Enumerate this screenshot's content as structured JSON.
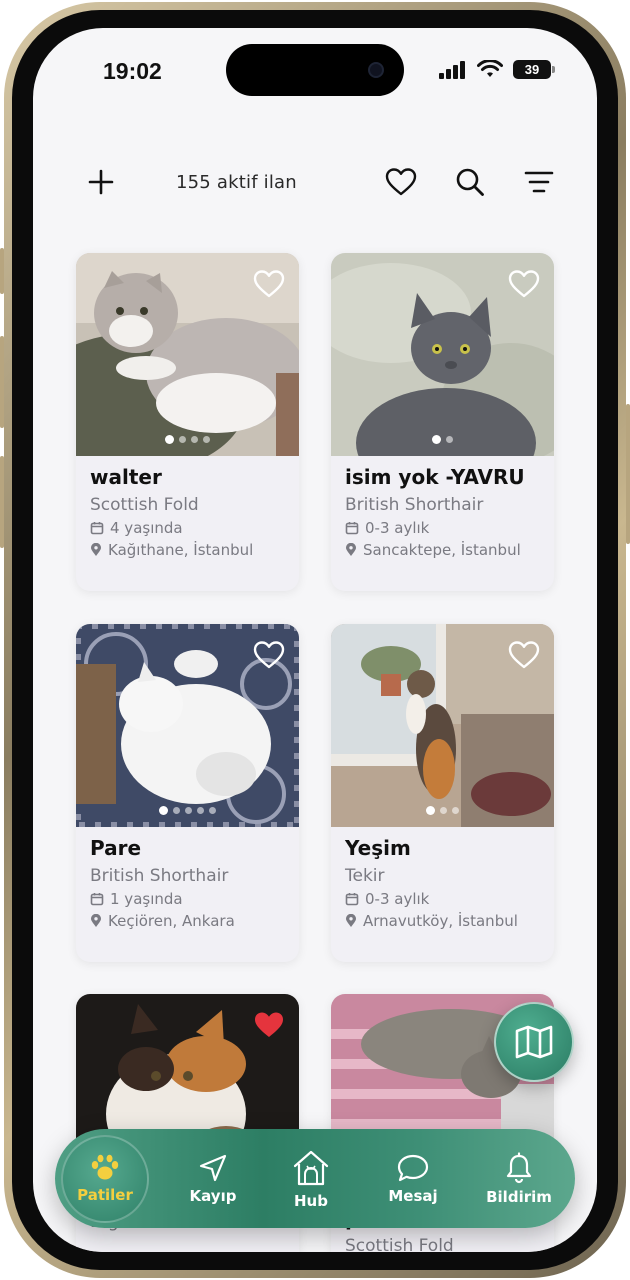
{
  "status_bar": {
    "time": "19:02",
    "battery": "39"
  },
  "toolbar": {
    "listing_count": "155 aktif ilan"
  },
  "listings": [
    {
      "name": "walter",
      "breed": "Scottish Fold",
      "age": "4 yaşında",
      "location": "Kağıthane, İstanbul",
      "favorited": false,
      "photo_count": 4,
      "active_photo": 1
    },
    {
      "name": "isim yok -YAVRU",
      "breed": "British Shorthair",
      "age": "0-3 aylık",
      "location": "Sancaktepe, İstanbul",
      "favorited": false,
      "photo_count": 2,
      "active_photo": 1
    },
    {
      "name": "Pare",
      "breed": "British Shorthair",
      "age": "1 yaşında",
      "location": "Keçiören, Ankara",
      "favorited": false,
      "photo_count": 5,
      "active_photo": 1
    },
    {
      "name": "Yeşim",
      "breed": "Tekir",
      "age": "0-3 aylık",
      "location": "Arnavutköy, İstanbul",
      "favorited": false,
      "photo_count": 3,
      "active_photo": 1
    },
    {
      "name": "",
      "breed": "Diğer",
      "age": "",
      "location": "",
      "favorited": true,
      "photo_count": 0,
      "active_photo": 0
    },
    {
      "name": "paris",
      "breed": "Scottish Fold",
      "age": "",
      "location": "",
      "favorited": false,
      "photo_count": 0,
      "active_photo": 0
    }
  ],
  "bottom_nav": [
    {
      "label": "Patiler",
      "icon": "paw-icon",
      "active": true
    },
    {
      "label": "Kayıp",
      "icon": "navigation-arrow-icon",
      "active": false
    },
    {
      "label": "Hub",
      "icon": "pet-house-icon",
      "active": false
    },
    {
      "label": "Mesaj",
      "icon": "chat-bubble-icon",
      "active": false
    },
    {
      "label": "Bildirim",
      "icon": "bell-icon",
      "active": false
    }
  ],
  "colors": {
    "accent": "#2d7e64",
    "active_nav_label": "#f4cf3f",
    "favorite": "#e5343d",
    "muted_text": "#7a7a82"
  }
}
